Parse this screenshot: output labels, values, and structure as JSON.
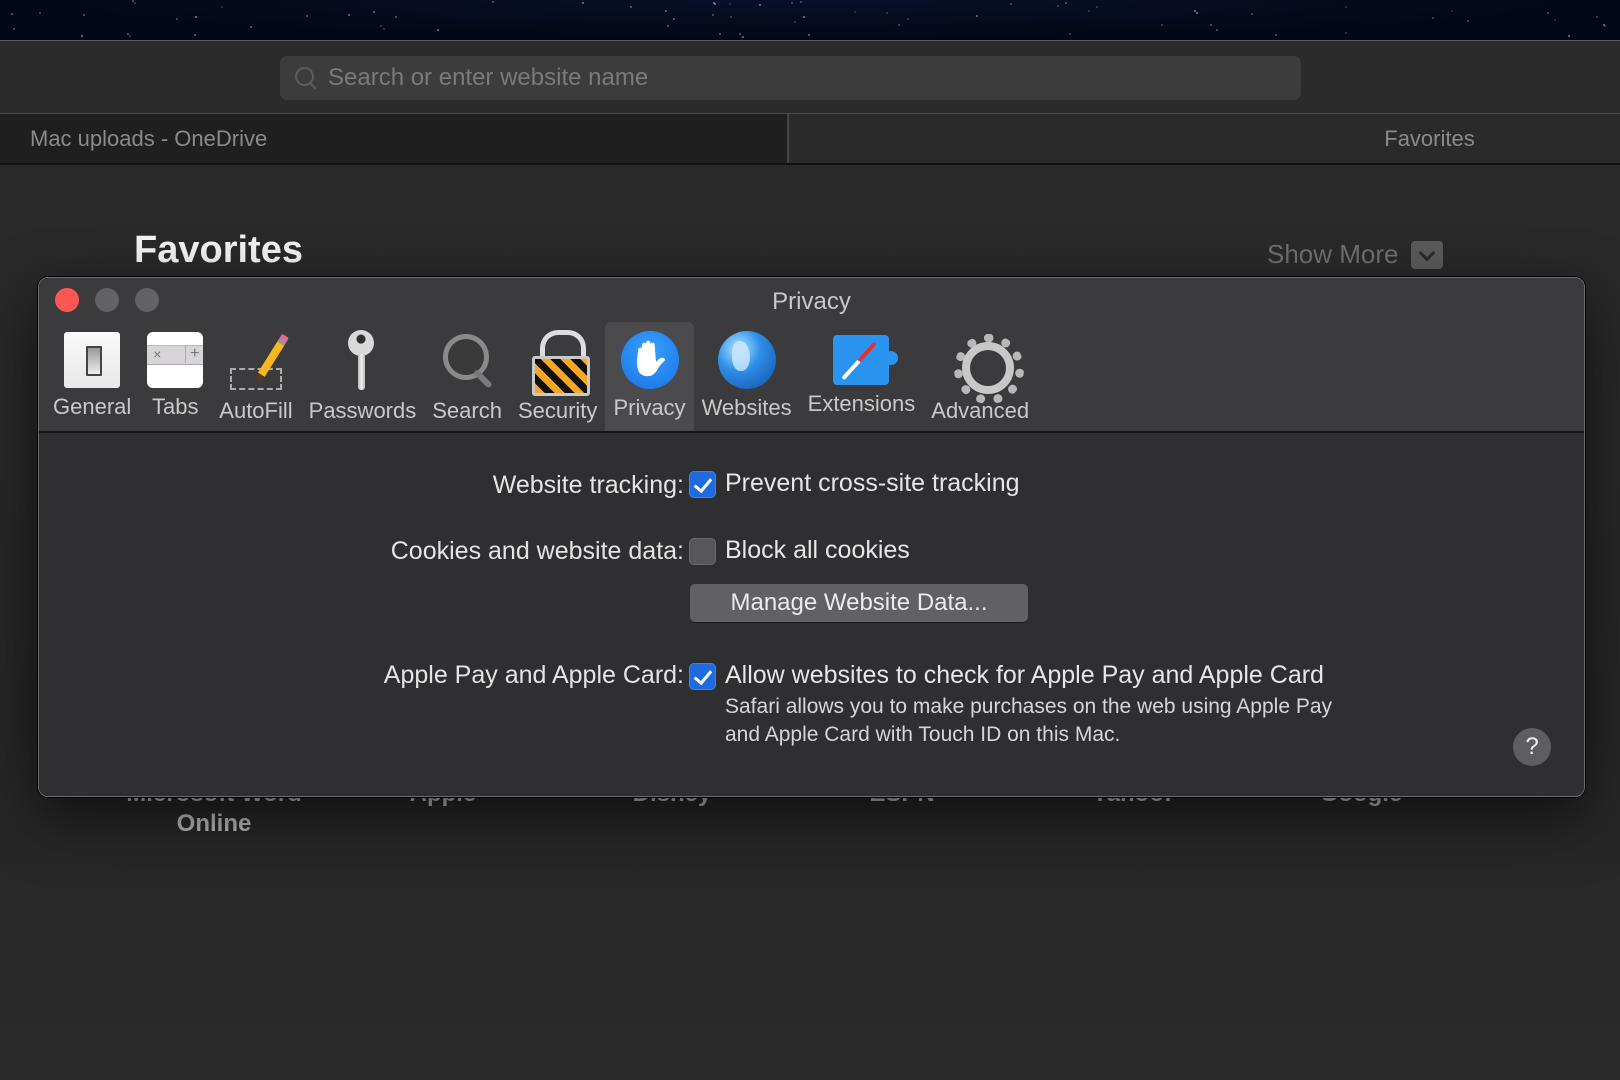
{
  "browser": {
    "search": {
      "placeholder": "Search or enter website name",
      "value": ""
    },
    "tabs": [
      {
        "label": "Mac uploads - OneDrive",
        "active": true
      },
      {
        "label": "Favorites",
        "active": false
      }
    ]
  },
  "start_page": {
    "heading": "Favorites",
    "show_more": "Show More",
    "favorites": [
      {
        "label": "Microsoft Word Online"
      },
      {
        "label": "Apple"
      },
      {
        "label": "Disney"
      },
      {
        "label": "ESPN"
      },
      {
        "label": "Yahoo!"
      },
      {
        "label": "Google"
      }
    ]
  },
  "dialog": {
    "title": "Privacy",
    "toolbar": [
      {
        "label": "General",
        "icon": "general-switch-icon"
      },
      {
        "label": "Tabs",
        "icon": "tabs-icon"
      },
      {
        "label": "AutoFill",
        "icon": "pencil-icon"
      },
      {
        "label": "Passwords",
        "icon": "key-icon"
      },
      {
        "label": "Search",
        "icon": "magnifier-icon"
      },
      {
        "label": "Security",
        "icon": "padlock-icon"
      },
      {
        "label": "Privacy",
        "icon": "hand-icon",
        "selected": true
      },
      {
        "label": "Websites",
        "icon": "globe-icon"
      },
      {
        "label": "Extensions",
        "icon": "puzzle-compass-icon"
      },
      {
        "label": "Advanced",
        "icon": "gear-icon"
      }
    ],
    "settings": {
      "tracking": {
        "label": "Website tracking:",
        "option": "Prevent cross-site tracking",
        "checked": true
      },
      "cookies": {
        "label": "Cookies and website data:",
        "option": "Block all cookies",
        "checked": false,
        "button": "Manage Website Data..."
      },
      "apple_pay": {
        "label": "Apple Pay and Apple Card:",
        "option": "Allow websites to check for Apple Pay and Apple Card",
        "checked": true,
        "description_line1": "Safari allows you to make purchases on the web using Apple Pay",
        "description_line2": "and Apple Card with Touch ID on this Mac."
      }
    },
    "help": "?"
  },
  "colors": {
    "accent": "#1f6ae0",
    "close_button": "#fd5754",
    "dialog_bg": "#2f2f31",
    "toolbar_bg": "#3b3b3d"
  }
}
